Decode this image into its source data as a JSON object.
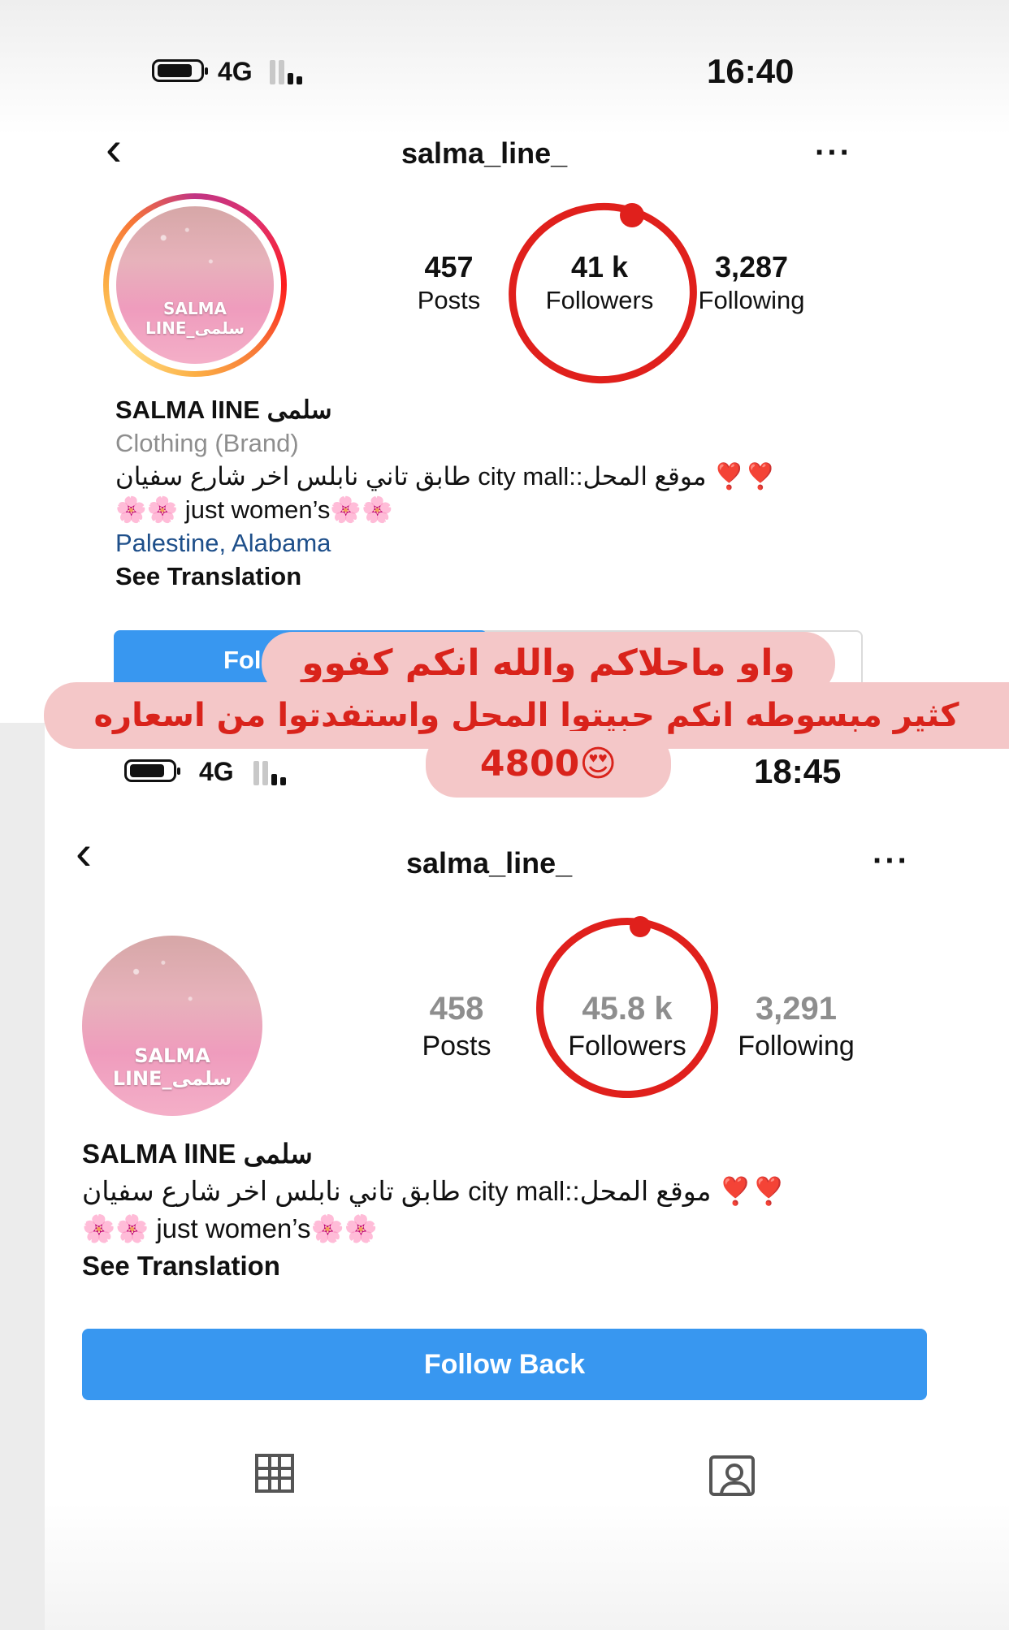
{
  "shot1": {
    "status": {
      "network": "4G",
      "time": "16:40"
    },
    "nav": {
      "back": "‹",
      "username": "salma_line_",
      "more": "···"
    },
    "avatar_text": "SALMA LINE_سلمى",
    "stats": [
      {
        "num": "457",
        "label": "Posts"
      },
      {
        "num": "41 k",
        "label": "Followers"
      },
      {
        "num": "3,287",
        "label": "Following"
      }
    ],
    "bio": {
      "name": "SALMA lINE سلمى",
      "category": "Clothing (Brand)",
      "line1": "❣️❣️ موقع المحل::city mall طابق تاني نابلس اخر شارع سفيان",
      "line2": "🌸🌸 just women’s🌸🌸",
      "location": "Palestine, Alabama",
      "see_translation": "See Translation"
    },
    "follow_label": "Fol"
  },
  "overlay": {
    "line1": "واو ماحلاكم والله انكم كفوو",
    "line2": "كثير مبسوطه انكم حبيتوا المحل واستفدتوا من اسعاره",
    "line3": "4800😍"
  },
  "shot2": {
    "status": {
      "network": "4G",
      "time": "18:45"
    },
    "nav": {
      "back": "‹",
      "username": "salma_line_",
      "more": "···"
    },
    "avatar_text": "SALMA LINE_سلمى",
    "stats": [
      {
        "num": "458",
        "label": "Posts"
      },
      {
        "num": "45.8 k",
        "label": "Followers"
      },
      {
        "num": "3,291",
        "label": "Following"
      }
    ],
    "bio": {
      "name": "SALMA lINE سلمى",
      "line1": "❣️❣️ موقع المحل::city mall طابق تاني نابلس اخر شارع سفيان",
      "line2": "🌸🌸 just women’s🌸🌸",
      "see_translation": "See Translation"
    },
    "follow_label": "Follow Back",
    "tabs": [
      "grid-icon",
      "tagged-icon"
    ]
  },
  "colors": {
    "accent": "#3897f0",
    "annotation_red": "#e0201c",
    "bubble": "#f4c7c8",
    "link": "#1e4f8a"
  }
}
